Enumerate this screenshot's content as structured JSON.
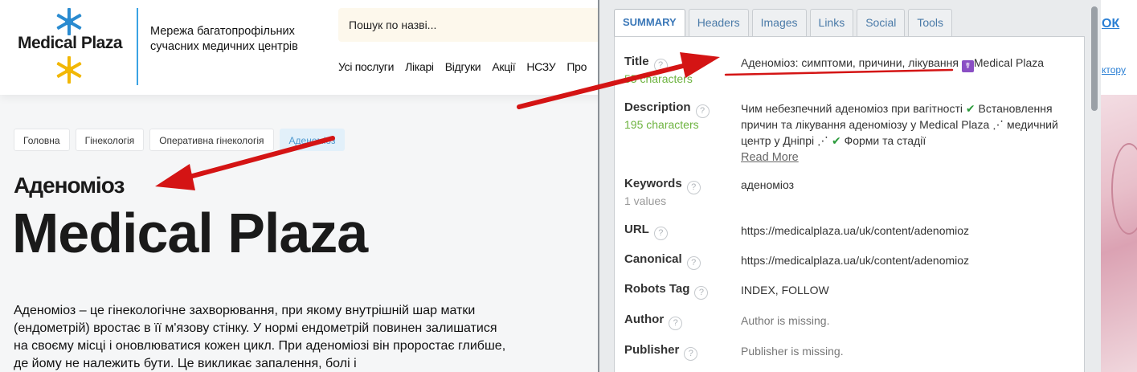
{
  "site": {
    "logo_text": "Medical Plaza",
    "tagline": "Мережа багатопрофільних сучасних медичних центрів",
    "search_placeholder": "Пошук по назві...",
    "nav": [
      "Усі послуги",
      "Лікарі",
      "Відгуки",
      "Акції",
      "НСЗУ",
      "Про"
    ],
    "right_link_1": "ОК",
    "right_link_2": "ктору"
  },
  "breadcrumb": [
    "Головна",
    "Гінекологія",
    "Оперативна гінекологія",
    "Аденоміоз"
  ],
  "page": {
    "title": "Аденоміоз",
    "brand": "Medical Plaza",
    "intro": "Аденоміоз – це гінекологічне захворювання, при якому внутрішній шар матки (ендометрій) вростає в її м'язову стінку. У нормі ендометрій повинен залишатися на своєму місці і оновлюватися кожен цикл. При аденоміозі він проростає глибше, де йому не належить бути. Це викликає запалення, болі і"
  },
  "extension": {
    "tabs": [
      "SUMMARY",
      "Headers",
      "Images",
      "Links",
      "Social",
      "Tools"
    ],
    "active_tab": "SUMMARY",
    "help_glyph": "?",
    "title": {
      "label": "Title",
      "sub": "55 characters",
      "value": "Аденоміоз: симптоми, причини, лікування",
      "emoji": "☤",
      "brand": "Medical Plaza"
    },
    "description": {
      "label": "Description",
      "sub": "195 characters",
      "part1": "Чим небезпечний аденоміоз при вагітності",
      "part2": "Встановлення причин та лікування аденоміозу у Medical Plaza ⋰ медичний центр у Дніпрі ⋰",
      "part3": "Форми та стадії",
      "check": "✔",
      "read_more": "Read More"
    },
    "keywords": {
      "label": "Keywords",
      "sub": "1 values",
      "value": "аденоміоз"
    },
    "url": {
      "label": "URL",
      "value": "https://medicalplaza.ua/uk/content/adenomioz"
    },
    "canonical": {
      "label": "Canonical",
      "value": "https://medicalplaza.ua/uk/content/adenomioz"
    },
    "robots": {
      "label": "Robots Tag",
      "value": "INDEX, FOLLOW"
    },
    "author": {
      "label": "Author",
      "value": "Author is missing."
    },
    "publisher": {
      "label": "Publisher",
      "value": "Publisher is missing."
    }
  },
  "colors": {
    "accent_blue": "#3aa3e3",
    "arrow_red": "#d41414",
    "characters_green": "#6db33f",
    "logo_blue": "#2a8bd0",
    "logo_yellow": "#f2b705"
  }
}
